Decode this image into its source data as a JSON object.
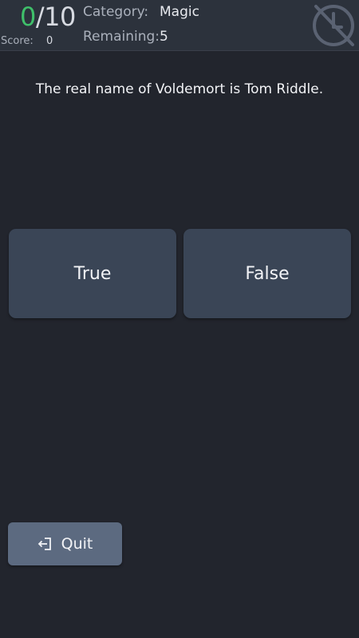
{
  "header": {
    "progress_current": "0",
    "progress_total": "/10",
    "score_label": "Score:",
    "score_value": "0",
    "category_label": "Category:",
    "category_value": "Magic",
    "remaining_label": "Remaining:",
    "remaining_value": "5",
    "timer_icon": "timer-off-icon"
  },
  "question": {
    "text": "The real name of Voldemort is Tom Riddle."
  },
  "answers": [
    {
      "label": "True"
    },
    {
      "label": "False"
    }
  ],
  "quit": {
    "label": "Quit",
    "icon": "exit-icon"
  },
  "colors": {
    "background": "#22252d",
    "header": "#2c323c",
    "answer_button": "#3a4556",
    "quit_button": "#5c6a80",
    "progress_current": "#3fbf6a"
  }
}
